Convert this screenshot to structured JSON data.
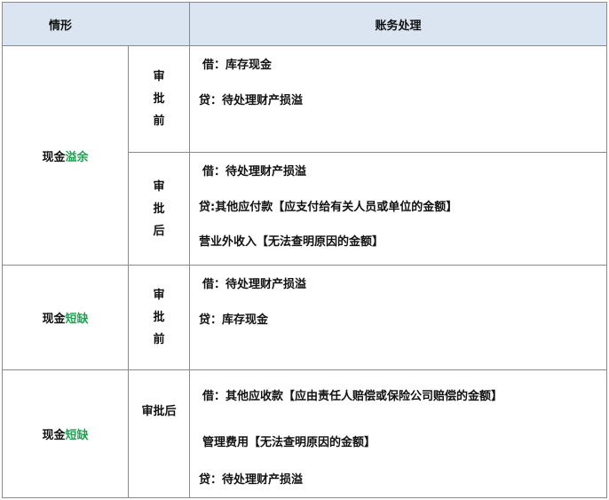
{
  "header": {
    "col1": "情形",
    "col2": "账务处理"
  },
  "rows": [
    {
      "situation": {
        "prefix": "现金",
        "highlight": "溢余"
      },
      "stages": [
        {
          "stage": [
            "审",
            "批",
            "前"
          ],
          "entries": [
            "借：库存现金",
            "贷：待处理财产损溢"
          ]
        },
        {
          "stage": [
            "审",
            "批",
            "后"
          ],
          "entries": [
            "借：待处理财产损溢",
            "贷:其他应付款【应支付给有关人员或单位的金额】",
            "营业外收入【无法查明原因的金额】"
          ]
        }
      ]
    },
    {
      "situation": {
        "prefix": "现金",
        "highlight": "短缺"
      },
      "stages": [
        {
          "stage": [
            "审",
            "批",
            "前"
          ],
          "entries": [
            "借：待处理财产损溢",
            "贷：库存现金"
          ]
        }
      ]
    },
    {
      "situation": {
        "prefix": "现金",
        "highlight": "短缺"
      },
      "stages": [
        {
          "stage": [
            "审批后"
          ],
          "entries": [
            "借：其他应收款【应由责任人赔偿或保险公司赔偿的金额】",
            "管理费用【无法查明原因的金额】",
            "贷：待处理财产损溢"
          ]
        }
      ]
    }
  ],
  "colors": {
    "header_bg": "#dbe5f1",
    "highlight": "#22a052",
    "border": "#8a8a8a"
  }
}
